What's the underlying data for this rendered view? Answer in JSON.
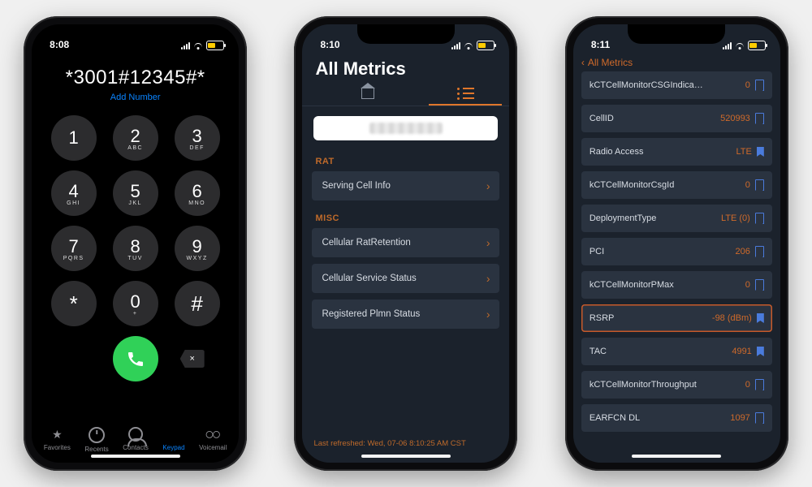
{
  "phone1": {
    "time": "8:08",
    "dialed": "*3001#12345#*",
    "add_number": "Add Number",
    "keys": [
      {
        "digit": "1",
        "letters": ""
      },
      {
        "digit": "2",
        "letters": "ABC"
      },
      {
        "digit": "3",
        "letters": "DEF"
      },
      {
        "digit": "4",
        "letters": "GHI"
      },
      {
        "digit": "5",
        "letters": "JKL"
      },
      {
        "digit": "6",
        "letters": "MNO"
      },
      {
        "digit": "7",
        "letters": "PQRS"
      },
      {
        "digit": "8",
        "letters": "TUV"
      },
      {
        "digit": "9",
        "letters": "WXYZ"
      },
      {
        "digit": "*",
        "letters": ""
      },
      {
        "digit": "0",
        "letters": "+"
      },
      {
        "digit": "#",
        "letters": ""
      }
    ],
    "tabs": [
      {
        "name": "favorites",
        "label": "Favorites"
      },
      {
        "name": "recents",
        "label": "Recents"
      },
      {
        "name": "contacts",
        "label": "Contacts"
      },
      {
        "name": "keypad",
        "label": "Keypad"
      },
      {
        "name": "voicemail",
        "label": "Voicemail"
      }
    ],
    "active_tab": "keypad",
    "backspace_glyph": "×"
  },
  "phone2": {
    "time": "8:10",
    "title": "All Metrics",
    "sections": {
      "rat": {
        "header": "RAT",
        "rows": [
          "Serving Cell Info"
        ]
      },
      "misc": {
        "header": "MISC",
        "rows": [
          "Cellular RatRetention",
          "Cellular Service Status",
          "Registered Plmn Status"
        ]
      }
    },
    "footer": "Last refreshed: Wed, 07-06 8:10:25 AM CST"
  },
  "phone3": {
    "time": "8:11",
    "back_label": "All Metrics",
    "rows": [
      {
        "label": "kCTCellMonitorCSGIndication",
        "value": "0",
        "bm": "outline",
        "bmColor": "blue"
      },
      {
        "label": "CellID",
        "value": "520993",
        "bm": "outline",
        "bmColor": "blue"
      },
      {
        "label": "Radio Access",
        "value": "LTE",
        "bm": "solid",
        "bmColor": "blue"
      },
      {
        "label": "kCTCellMonitorCsgId",
        "value": "0",
        "bm": "outline",
        "bmColor": "blue"
      },
      {
        "label": "DeploymentType",
        "value": "LTE (0)",
        "bm": "outline",
        "bmColor": "blue"
      },
      {
        "label": "PCI",
        "value": "206",
        "bm": "outline",
        "bmColor": "blue"
      },
      {
        "label": "kCTCellMonitorPMax",
        "value": "0",
        "bm": "outline",
        "bmColor": "blue"
      },
      {
        "label": "RSRP",
        "value": "-98 (dBm)",
        "bm": "solid",
        "bmColor": "blue",
        "highlight": true
      },
      {
        "label": "TAC",
        "value": "4991",
        "bm": "solid",
        "bmColor": "blue"
      },
      {
        "label": "kCTCellMonitorThroughput",
        "value": "0",
        "bm": "outline",
        "bmColor": "blue"
      },
      {
        "label": "EARFCN DL",
        "value": "1097",
        "bm": "outline",
        "bmColor": "blue"
      }
    ]
  }
}
